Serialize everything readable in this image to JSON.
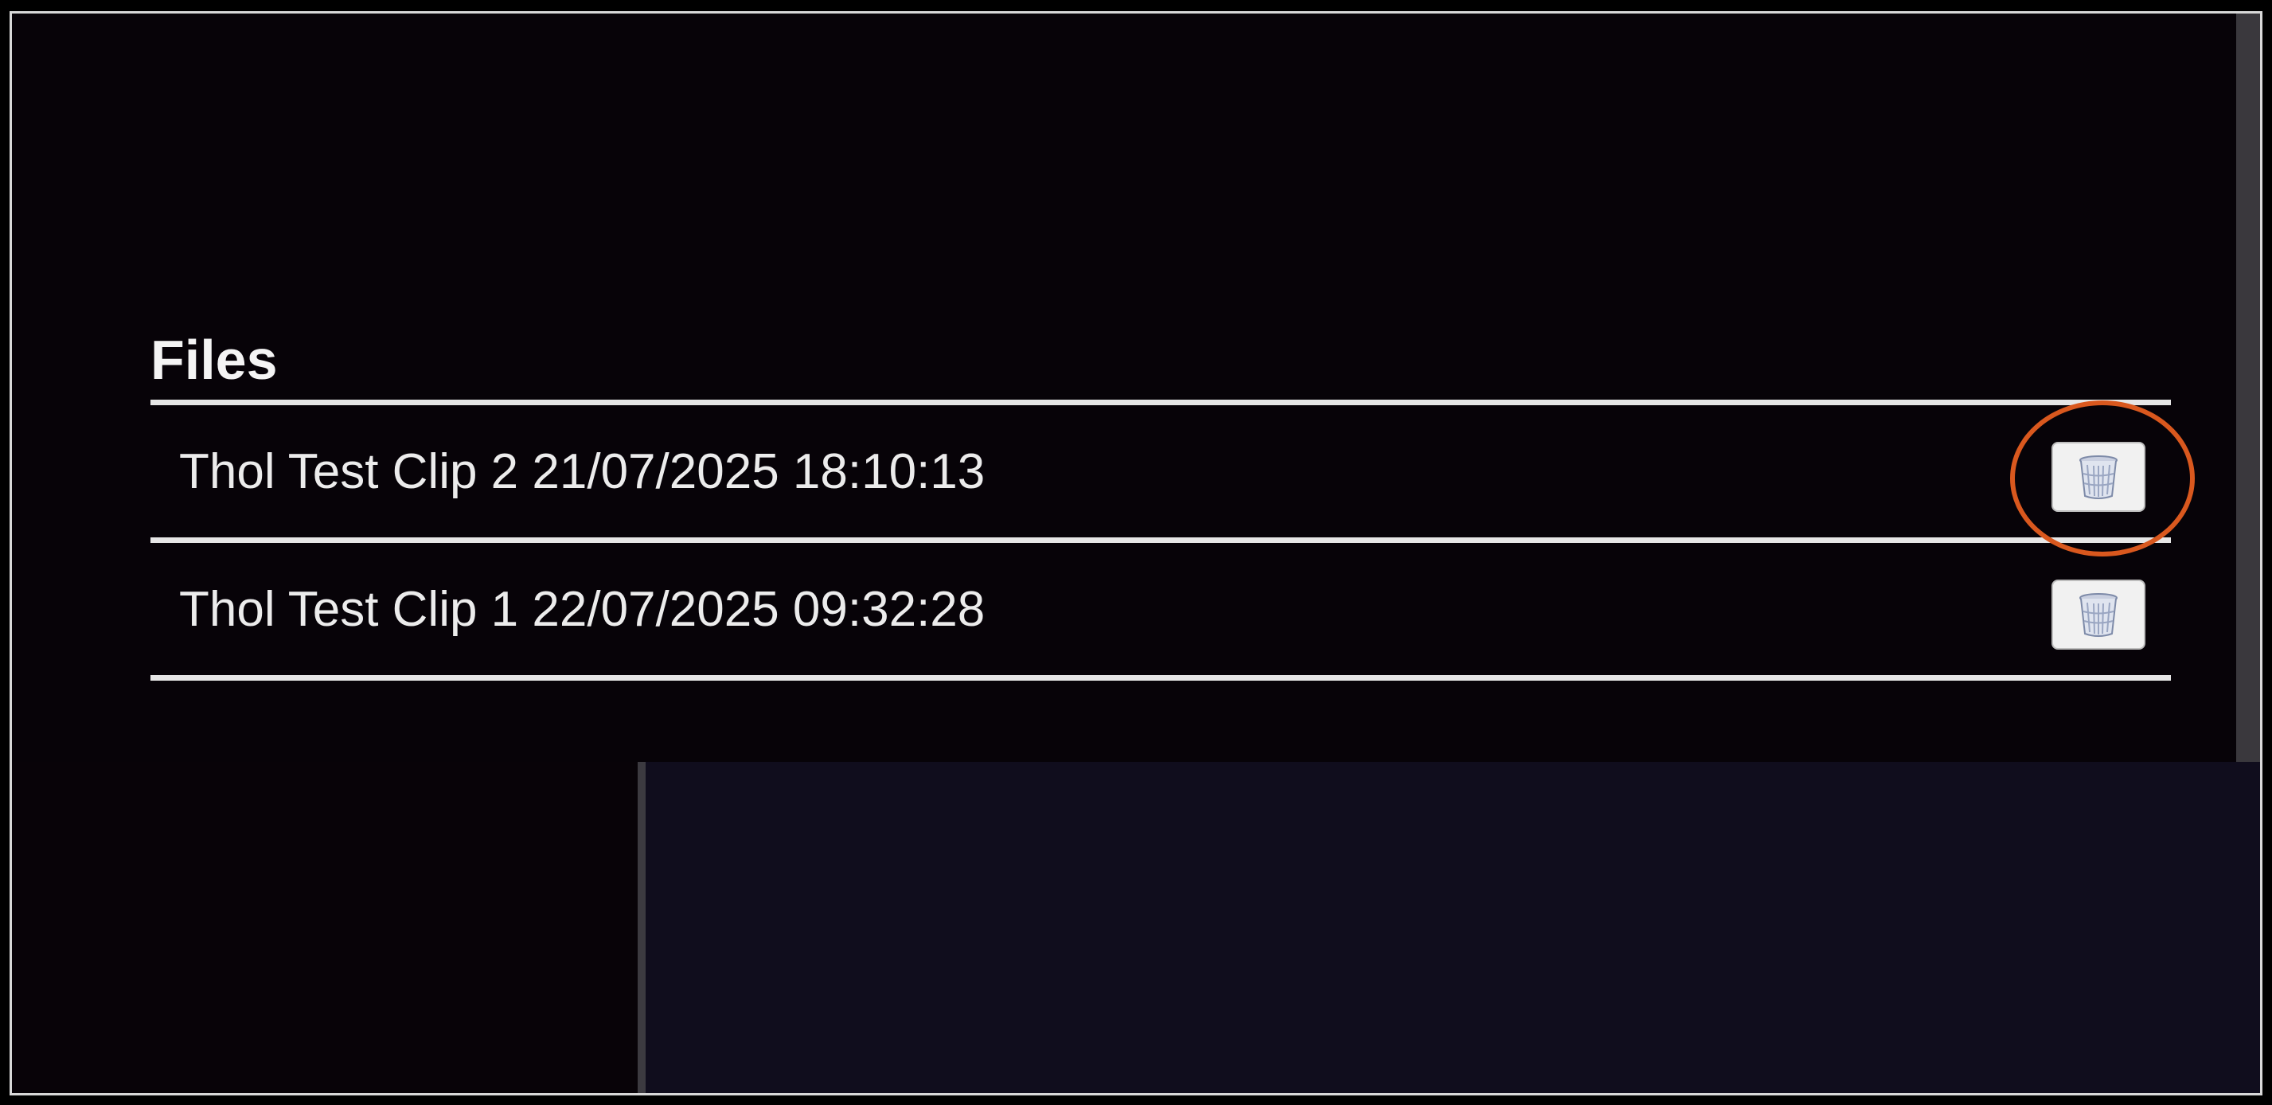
{
  "files": {
    "title": "Files",
    "items": [
      {
        "label": "Thol Test Clip 2 21/07/2025 18:10:13",
        "delete_icon": "trash-icon",
        "highlighted": true
      },
      {
        "label": "Thol Test Clip 1 22/07/2025 09:32:28",
        "delete_icon": "trash-icon",
        "highlighted": false
      }
    ]
  },
  "colors": {
    "background": "#080308",
    "bottom_panel": "#100d1d",
    "highlight": "#d9581e",
    "rule": "#e6e6e6",
    "text": "#ececec"
  }
}
